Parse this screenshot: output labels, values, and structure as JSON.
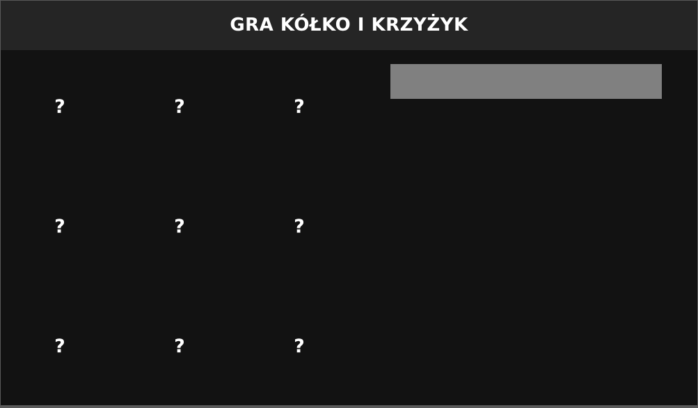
{
  "header": {
    "title": "GRA KÓŁKO I KRZYŻYK"
  },
  "board": {
    "cells": [
      "?",
      "?",
      "?",
      "?",
      "?",
      "?",
      "?",
      "?",
      "?"
    ]
  },
  "status": {
    "text": ""
  }
}
